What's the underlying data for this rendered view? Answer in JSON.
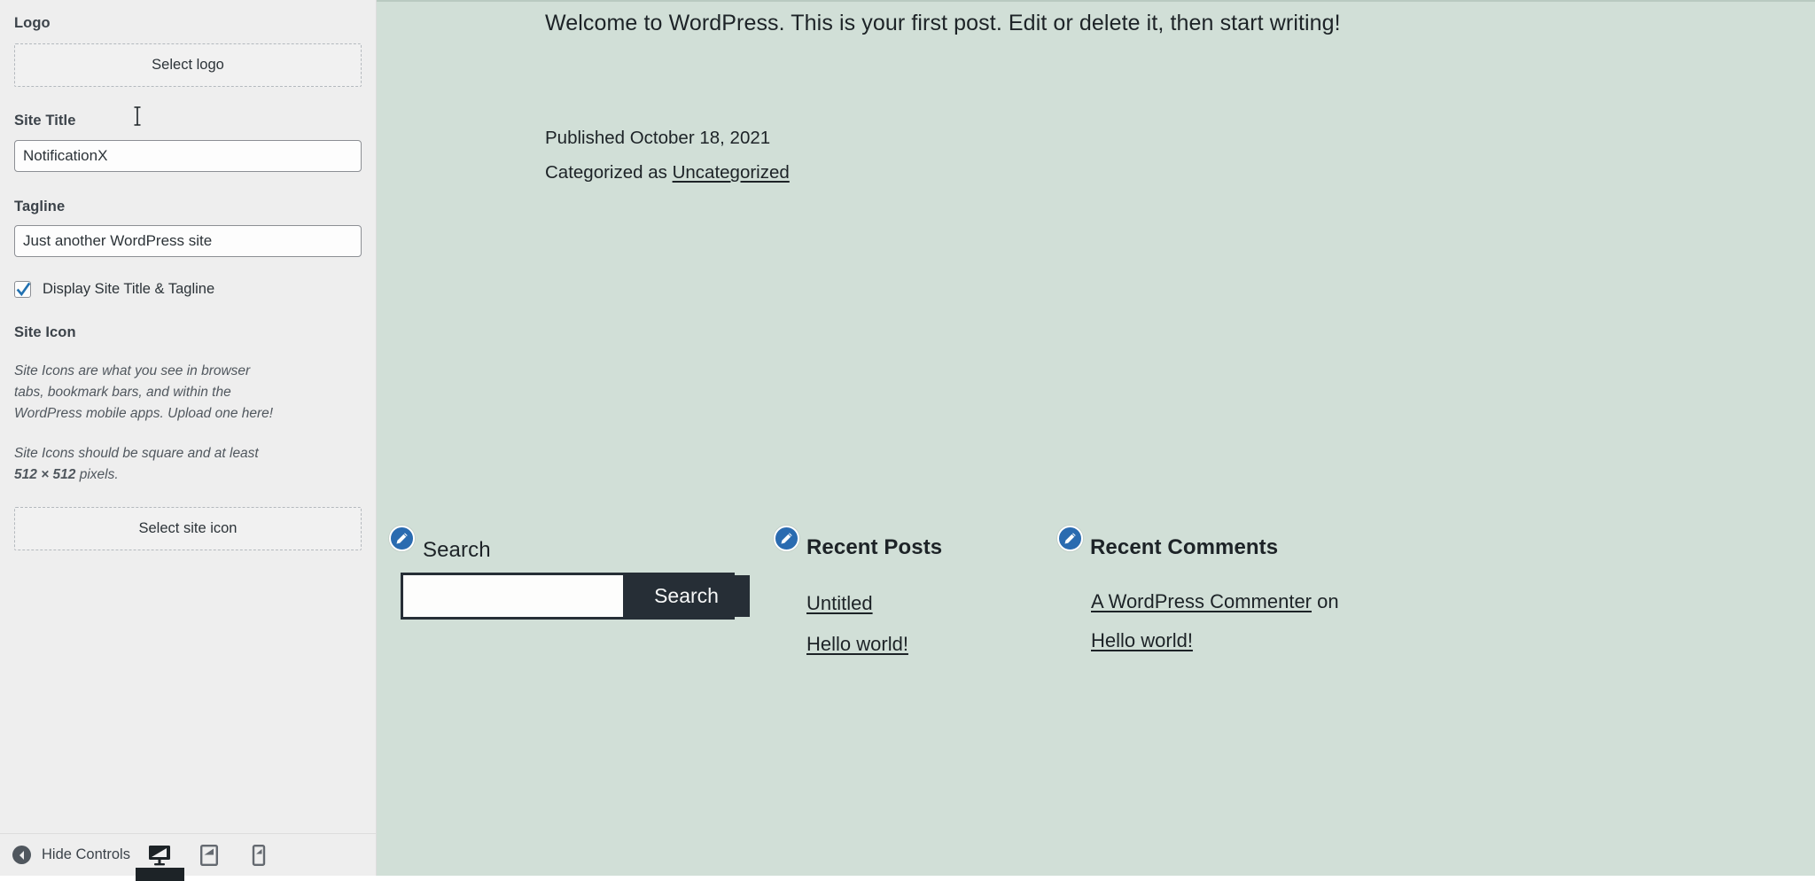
{
  "sidebar": {
    "logo": {
      "label": "Logo",
      "button_label": "Select logo"
    },
    "site_title": {
      "label": "Site Title",
      "value": "NotificationX"
    },
    "tagline": {
      "label": "Tagline",
      "value": "Just another WordPress site"
    },
    "display_title_tagline": {
      "label": "Display Site Title & Tagline",
      "checked": true
    },
    "site_icon": {
      "label": "Site Icon",
      "description_1": "Site Icons are what you see in browser tabs, bookmark bars, and within the WordPress mobile apps. Upload one here!",
      "description_2_prefix": "Site Icons should be square and at least ",
      "description_2_bold": "512 × 512",
      "description_2_suffix": " pixels.",
      "button_label": "Select site icon"
    },
    "footer": {
      "hide_controls_label": "Hide Controls",
      "collapse_icon": "chevron-left-circle-icon",
      "devices": [
        {
          "name": "desktop",
          "icon": "desktop-icon",
          "active": true
        },
        {
          "name": "tablet",
          "icon": "tablet-icon",
          "active": false
        },
        {
          "name": "mobile",
          "icon": "mobile-icon",
          "active": false
        }
      ]
    }
  },
  "preview": {
    "background_color": "#d1dfd7",
    "post": {
      "paragraph": "Welcome to WordPress. This is your first post. Edit or delete it, then start writing!",
      "published": "Published October 18, 2021",
      "categorized_prefix": "Categorized as ",
      "category_link": "Uncategorized"
    },
    "widgets": {
      "search": {
        "edit_icon": "edit-pencil-icon",
        "title": "Search",
        "field_value": "",
        "submit_label": "Search"
      },
      "recent_posts": {
        "edit_icon": "edit-pencil-icon",
        "title": "Recent Posts",
        "items": [
          {
            "label": "Untitled"
          },
          {
            "label": "Hello world!"
          }
        ]
      },
      "recent_comments": {
        "edit_icon": "edit-pencil-icon",
        "title": "Recent Comments",
        "items": [
          {
            "link": "A WordPress Commenter",
            "suffix": " on"
          },
          {
            "link": "Hello world!",
            "suffix": ""
          }
        ]
      }
    }
  },
  "colors": {
    "sidebar_bg": "#eeeeee",
    "preview_bg": "#d1dfd7",
    "accent_blue": "#2a6bb0",
    "dark": "#1d2327",
    "search_bar": "#262e36"
  }
}
